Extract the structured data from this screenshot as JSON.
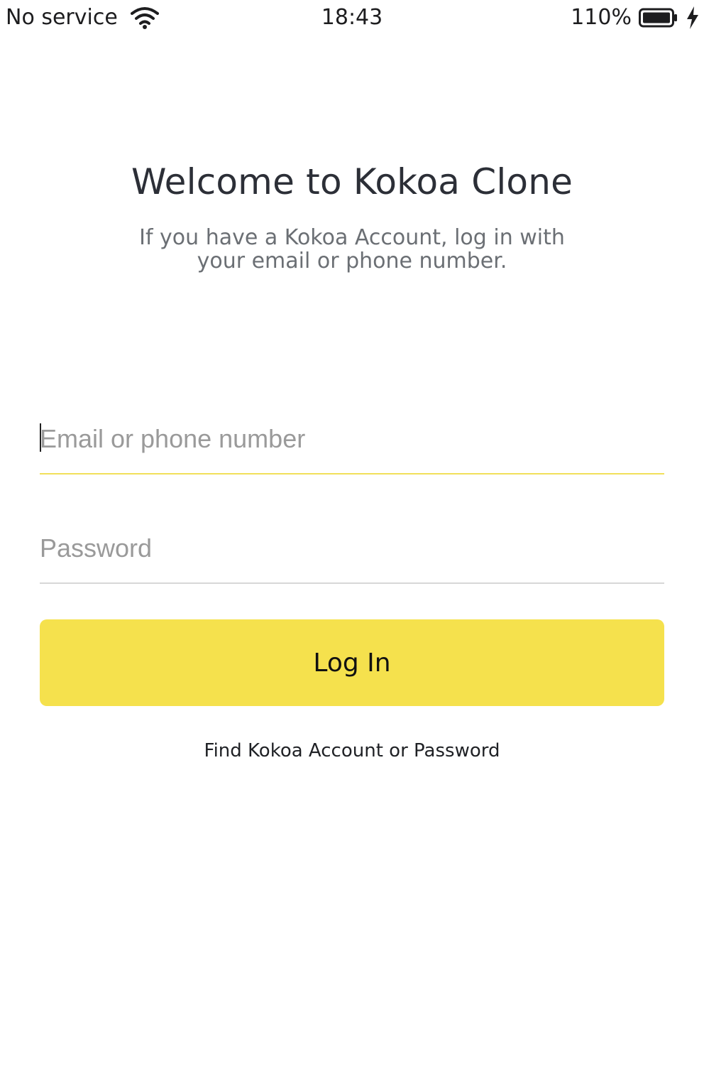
{
  "status_bar": {
    "carrier": "No service",
    "time": "18:43",
    "battery_percent": "110%",
    "icons": [
      "wifi-icon",
      "battery-icon",
      "charging-icon"
    ]
  },
  "header": {
    "title": "Welcome to Kokoa Clone",
    "subtitle": "If you have a Kokoa Account, log in with your email or phone number."
  },
  "form": {
    "email": {
      "placeholder": "Email or phone number",
      "value": ""
    },
    "password": {
      "placeholder": "Password",
      "value": ""
    },
    "login_label": "Log In",
    "find_link": "Find Kokoa Account or Password"
  },
  "colors": {
    "accent": "#f5e14d",
    "active_underline": "#f2e05a",
    "title": "#2c2f37",
    "subtitle": "#6b6f74"
  }
}
